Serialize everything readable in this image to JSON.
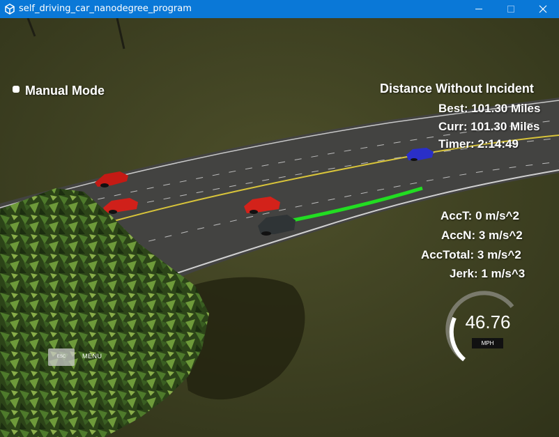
{
  "window": {
    "title": "self_driving_car_nanodegree_program"
  },
  "hud": {
    "mode_label": "Manual Mode",
    "distance_heading": "Distance Without Incident",
    "best": "Best: 101.30 Miles",
    "curr": "Curr: 101.30 Miles",
    "timer": "Timer: 2:14:49",
    "acc_t": "AccT: 0 m/s^2",
    "acc_n": "AccN: 3 m/s^2",
    "acc_total": "AccTotal: 3 m/s^2",
    "jerk": "Jerk: 1 m/s^3"
  },
  "menu": {
    "esc_label": "ESC",
    "menu_label": "MENU"
  },
  "speedometer": {
    "value": "46.76",
    "unit": "MPH",
    "fraction": 0.47
  },
  "colors": {
    "titlebar": "#0a78d7",
    "grass": "#3c3f20",
    "road": "#434341",
    "lane_yellow": "#d8c43a",
    "path_green": "#22dd22",
    "car_red": "#c41a14",
    "car_blue": "#2a2fc8",
    "ego_car": "#2f3436"
  }
}
